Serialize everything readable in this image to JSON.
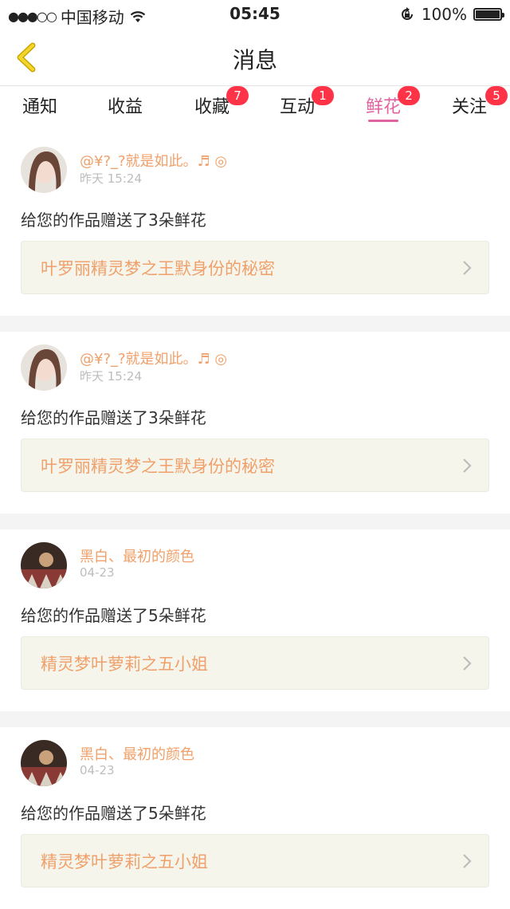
{
  "status_bar": {
    "signal_dots": "●●●○○",
    "carrier": "中国移动",
    "wifi_icon": "wifi-icon",
    "time": "05:45",
    "battery_percent": "100%"
  },
  "nav": {
    "title": "消息",
    "back_icon": "back-chevron-icon"
  },
  "tabs": [
    {
      "label": "通知",
      "badge": ""
    },
    {
      "label": "收益",
      "badge": ""
    },
    {
      "label": "收藏",
      "badge": "7"
    },
    {
      "label": "互动",
      "badge": "1"
    },
    {
      "label": "鲜花",
      "badge": "2",
      "active": true
    },
    {
      "label": "关注",
      "badge": "5"
    }
  ],
  "colors": {
    "accent": "#e064a0",
    "badge": "#ff3347",
    "username": "#f0a06a",
    "link_bg": "#f5f5ec"
  },
  "messages": [
    {
      "user": "@¥?_?就是如此。♬ ◎",
      "time": "昨天 15:24",
      "text": "给您的作品赠送了3朵鲜花",
      "work": "叶罗丽精灵梦之王默身份的秘密"
    },
    {
      "user": "@¥?_?就是如此。♬ ◎",
      "time": "昨天 15:24",
      "text": "给您的作品赠送了3朵鲜花",
      "work": "叶罗丽精灵梦之王默身份的秘密"
    },
    {
      "user": "黑白、最初的颜色",
      "time": "04-23",
      "text": "给您的作品赠送了5朵鲜花",
      "work": "精灵梦叶萝莉之五小姐"
    },
    {
      "user": "黑白、最初的颜色",
      "time": "04-23",
      "text": "给您的作品赠送了5朵鲜花",
      "work": "精灵梦叶萝莉之五小姐"
    }
  ]
}
